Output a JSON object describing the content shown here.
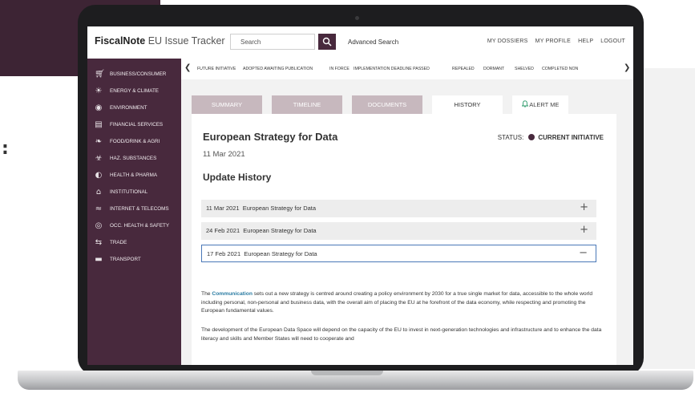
{
  "app": {
    "brand_bold": "FiscalNote",
    "brand_light": " EU Issue Tracker",
    "search_placeholder": "Search",
    "advanced_search": "Advanced Search",
    "top_links": [
      "MY DOSSIERS",
      "MY PROFILE",
      "HELP",
      "LOGOUT"
    ]
  },
  "sidebar": {
    "items": [
      {
        "label": "BUSINESS/CONSUMER",
        "icon": "cart-icon"
      },
      {
        "label": "ENERGY & CLIMATE",
        "icon": "sun-icon"
      },
      {
        "label": "ENVIRONMENT",
        "icon": "globe-icon"
      },
      {
        "label": "FINANCIAL SERVICES",
        "icon": "bank-icon"
      },
      {
        "label": "FOOD/DRINK & AGRI",
        "icon": "wheat-icon"
      },
      {
        "label": "HAZ. SUBSTANCES",
        "icon": "hazard-icon"
      },
      {
        "label": "HEALTH & PHARMA",
        "icon": "pill-icon"
      },
      {
        "label": "INSTITUTIONAL",
        "icon": "building-icon"
      },
      {
        "label": "INTERNET & TELECOMS",
        "icon": "wifi-icon"
      },
      {
        "label": "OCC. HEALTH & SAFETY",
        "icon": "lifebuoy-icon"
      },
      {
        "label": "TRADE",
        "icon": "exchange-icon"
      },
      {
        "label": "TRANSPORT",
        "icon": "truck-icon"
      }
    ]
  },
  "status_nav": {
    "items": [
      "FUTURE INITIATIVE",
      "ADOPTED AWAITING PUBLICATION",
      "IN FORCE",
      "IMPLEMENTATION DEADLINE PASSED",
      "REPEALED",
      "DORMANT",
      "SHELVED",
      "COMPLETED NON"
    ]
  },
  "tabs": {
    "summary": "SUMMARY",
    "timeline": "TIMELINE",
    "documents": "DOCUMENTS",
    "history": "HISTORY",
    "alert": "ALERT ME"
  },
  "document": {
    "title": "European Strategy for Data",
    "status_label": "STATUS:",
    "status_value": "CURRENT INITIATIVE",
    "date": "11 Mar 2021",
    "update_history_heading": "Update History",
    "history": [
      {
        "date": "11 Mar 2021",
        "title": "European Strategy for Data",
        "toggle": "+"
      },
      {
        "date": "24 Feb 2021",
        "title": "European Strategy for Data",
        "toggle": "+"
      },
      {
        "date": "17 Feb 2021",
        "title": "European Strategy for Data",
        "toggle": "−"
      }
    ],
    "para1_pre": "The ",
    "para1_link": "Communication",
    "para1_post": " sets out a new strategy is centred around creating a policy environment by 2030 for a true single market for data, accessible to the whole world including personal, non-personal and business data, with the overall aim of placing the EU at he forefront of the data economy, while respecting and promoting the European fundamental values.",
    "para2": "The development of the European Data Space will depend on the capacity of the EU to invest in next-generation technologies and infrastructure and to enhance the data literacy and skills and Member States will need to cooperate and"
  },
  "colors": {
    "brand_purple": "#48293d",
    "tab_inactive": "#c7b8be",
    "open_border": "#4a78b8",
    "link": "#2b7ca3"
  }
}
